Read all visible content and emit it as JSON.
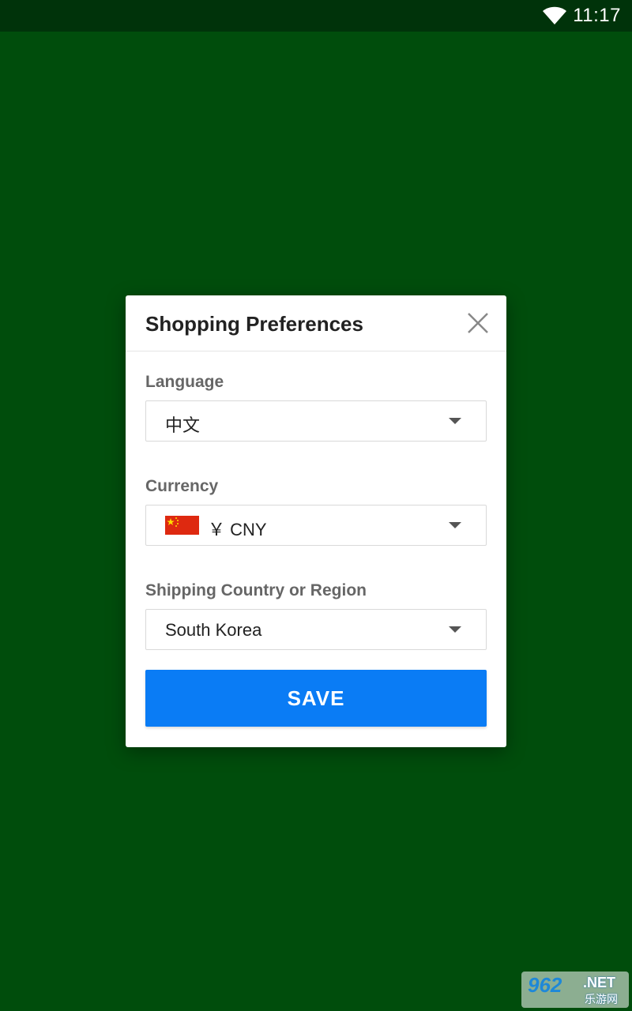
{
  "status_bar": {
    "time": "11:17",
    "wifi_icon": "wifi-icon"
  },
  "dialog": {
    "title": "Shopping Preferences",
    "close_icon": "close-icon",
    "language": {
      "label": "Language",
      "value": "中文"
    },
    "currency": {
      "label": "Currency",
      "value": "￥ CNY",
      "flag_icon": "china-flag-icon"
    },
    "shipping": {
      "label": "Shipping Country or Region",
      "value": "South Korea"
    },
    "save_label": "SAVE"
  },
  "watermark": {
    "main": "962",
    "net": ".NET",
    "sub": "乐游网"
  },
  "colors": {
    "background": "#004d0c",
    "status_bar": "#00330a",
    "accent": "#0a7cf5"
  }
}
